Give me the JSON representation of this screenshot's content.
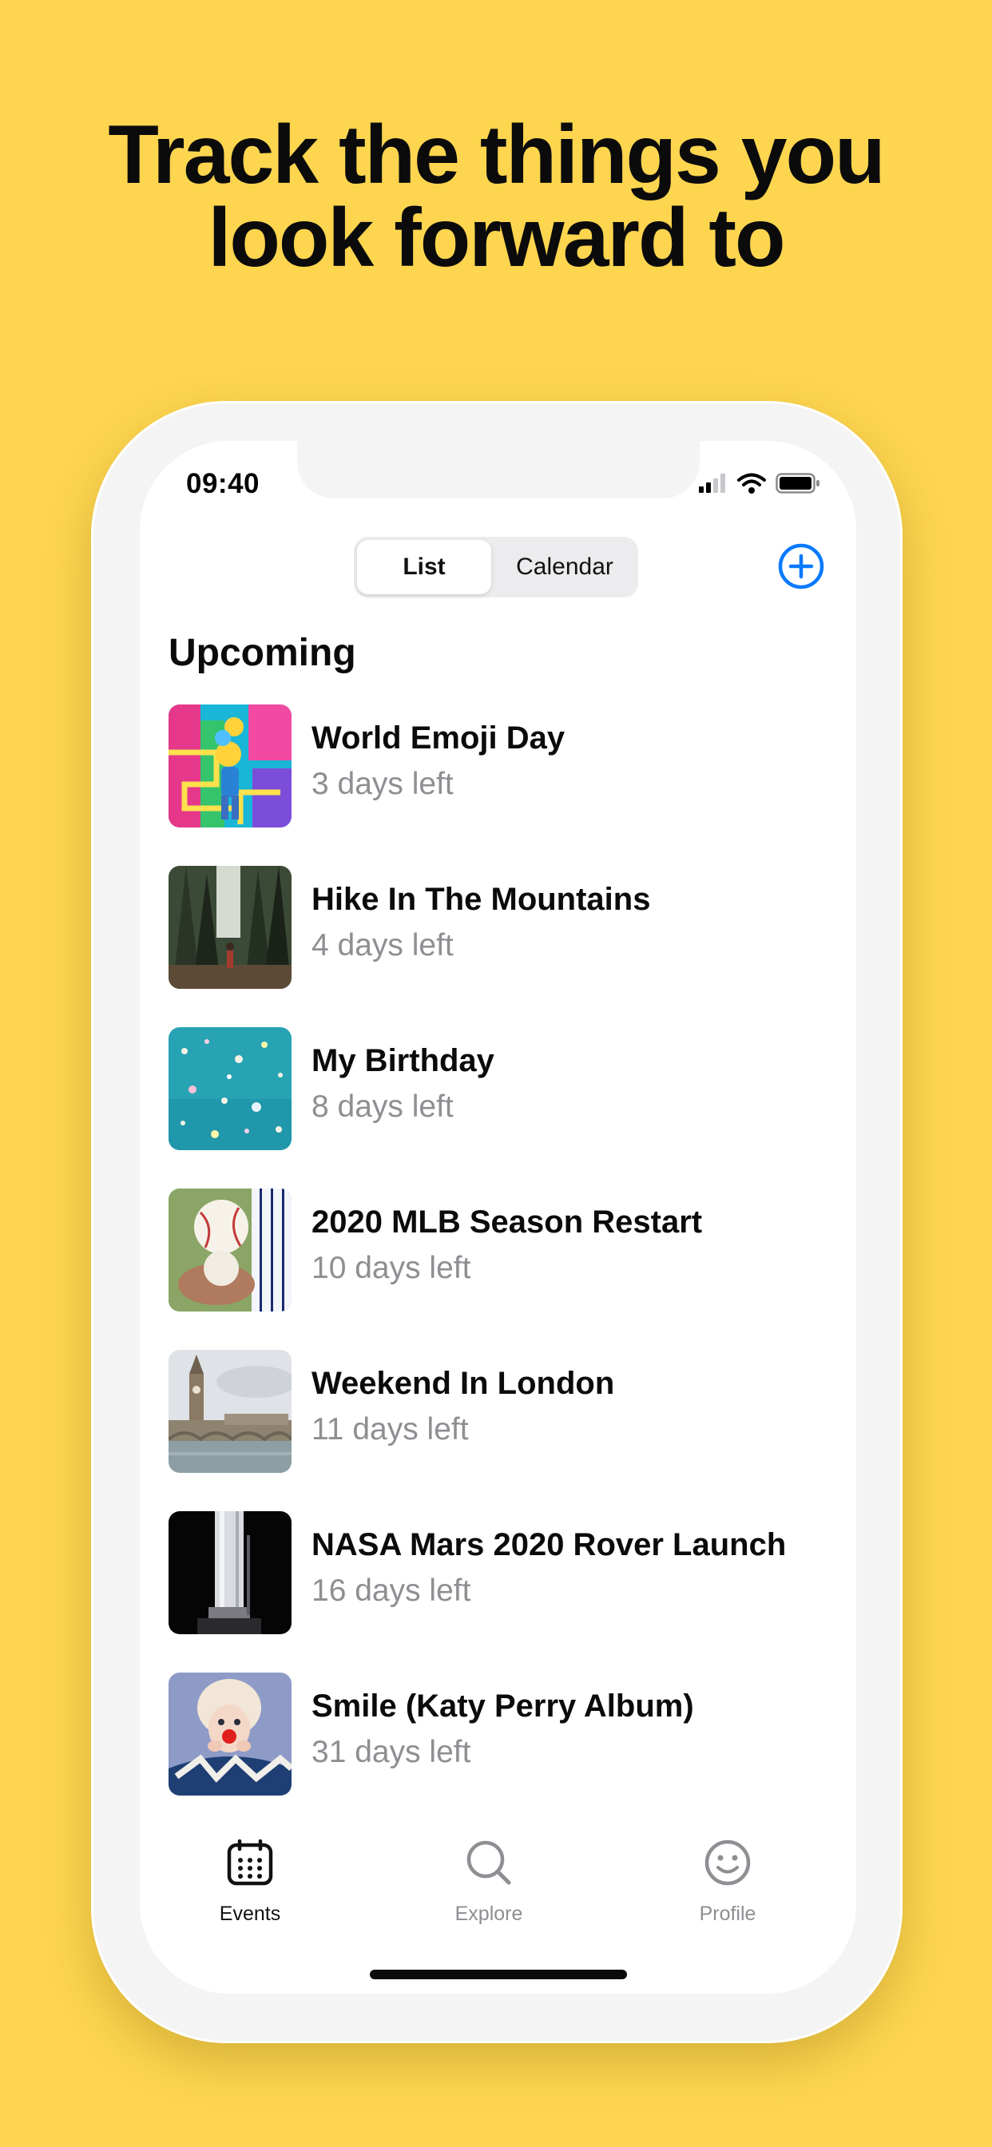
{
  "headline": {
    "line1": "Track the things you",
    "line2": "look forward to"
  },
  "status_bar": {
    "time": "09:40",
    "icons": [
      "signal-icon",
      "wifi-icon",
      "battery-icon"
    ]
  },
  "segmented_control": {
    "options": [
      {
        "label": "List",
        "selected": true
      },
      {
        "label": "Calendar",
        "selected": false
      }
    ]
  },
  "header": {
    "add_icon": "plus-circle-icon"
  },
  "section": {
    "title": "Upcoming"
  },
  "events": [
    {
      "name": "World Emoji Day",
      "days_left": "3 days left"
    },
    {
      "name": "Hike In The Mountains",
      "days_left": "4 days left"
    },
    {
      "name": "My Birthday",
      "days_left": "8 days left"
    },
    {
      "name": "2020 MLB Season Restart",
      "days_left": "10 days left"
    },
    {
      "name": "Weekend In London",
      "days_left": "11 days left"
    },
    {
      "name": "NASA Mars 2020 Rover Launch",
      "days_left": "16 days left"
    },
    {
      "name": "Smile (Katy Perry Album)",
      "days_left": "31 days left"
    }
  ],
  "tab_bar": {
    "tabs": [
      {
        "label": "Events",
        "icon": "calendar-icon",
        "active": true
      },
      {
        "label": "Explore",
        "icon": "search-icon",
        "active": false
      },
      {
        "label": "Profile",
        "icon": "smiley-icon",
        "active": false
      }
    ]
  },
  "colors": {
    "background": "#FDD54F",
    "accent": "#0A7AFF",
    "secondary_text": "#8E8E93"
  }
}
